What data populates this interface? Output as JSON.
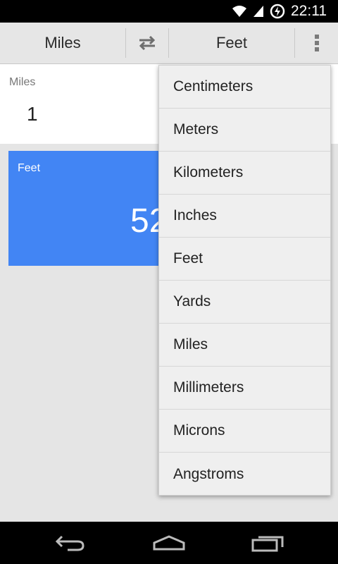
{
  "status_bar": {
    "time": "22:11",
    "icons": [
      "wifi-icon",
      "signal-icon",
      "battery-charging-icon"
    ]
  },
  "toolbar": {
    "from_unit": "Miles",
    "to_unit": "Feet",
    "swap_icon": "swap-icon",
    "menu_icon": "overflow-menu-icon"
  },
  "input": {
    "label": "Miles",
    "value": "1"
  },
  "result": {
    "label": "Feet",
    "value_visible": "52"
  },
  "dropdown": {
    "items": [
      {
        "label": "Centimeters"
      },
      {
        "label": "Meters"
      },
      {
        "label": "Kilometers"
      },
      {
        "label": "Inches"
      },
      {
        "label": "Feet"
      },
      {
        "label": "Yards"
      },
      {
        "label": "Miles"
      },
      {
        "label": "Millimeters"
      },
      {
        "label": "Microns"
      },
      {
        "label": "Angstroms"
      }
    ]
  },
  "nav": {
    "back_icon": "back-icon",
    "home_icon": "home-icon",
    "recents_icon": "recents-icon"
  },
  "colors": {
    "accent": "#4285f4",
    "toolbar_bg": "#e6e6e6",
    "dropdown_bg": "#efefef"
  }
}
